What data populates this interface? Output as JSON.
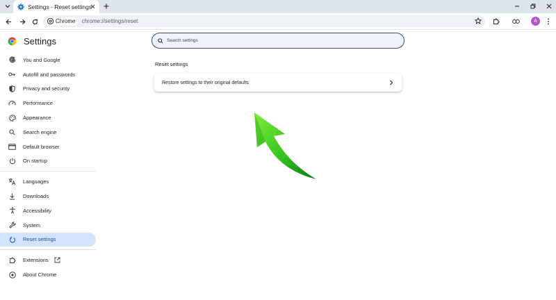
{
  "browser": {
    "tab_title": "Settings - Reset settings",
    "chip_label": "Chrome",
    "url": "chrome://settings/reset",
    "avatar_letter": "A"
  },
  "settings": {
    "title": "Settings",
    "search_placeholder": "Search settings",
    "nav_items": [
      {
        "label": "You and Google",
        "icon": "google-icon"
      },
      {
        "label": "Autofill and passwords",
        "icon": "key-icon"
      },
      {
        "label": "Privacy and security",
        "icon": "shield-icon"
      },
      {
        "label": "Performance",
        "icon": "speedometer-icon"
      },
      {
        "label": "Appearance",
        "icon": "palette-icon"
      },
      {
        "label": "Search engine",
        "icon": "search-icon"
      },
      {
        "label": "Default browser",
        "icon": "browser-window-icon"
      },
      {
        "label": "On startup",
        "icon": "power-icon"
      },
      {
        "label": "Languages",
        "icon": "translate-icon"
      },
      {
        "label": "Downloads",
        "icon": "download-icon"
      },
      {
        "label": "Accessibility",
        "icon": "accessibility-icon"
      },
      {
        "label": "System",
        "icon": "wrench-icon"
      },
      {
        "label": "Reset settings",
        "icon": "reset-icon",
        "active": true
      },
      {
        "label": "Extensions",
        "icon": "puzzle-icon"
      },
      {
        "label": "About Chrome",
        "icon": "chrome-icon"
      }
    ],
    "section_title": "Reset settings",
    "restore_label": "Restore settings to their original defaults"
  },
  "colors": {
    "accent": "#0b57d0",
    "active_nav_bg": "#d3e3fd",
    "tab_strip": "#dde3ea",
    "annotation_arrow": "#3fc41a"
  }
}
